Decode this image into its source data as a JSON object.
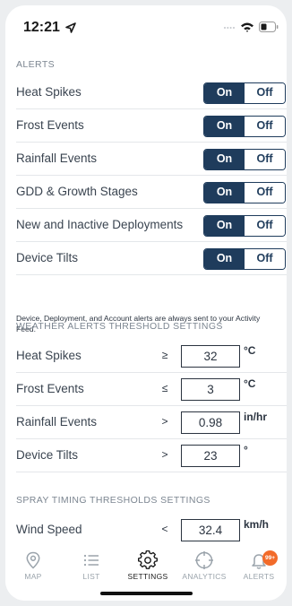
{
  "status_bar": {
    "time": "12:21"
  },
  "alerts": {
    "header": "ALERTS",
    "items": [
      {
        "label": "Heat Spikes",
        "on": "On",
        "off": "Off",
        "state": "on"
      },
      {
        "label": "Frost Events",
        "on": "On",
        "off": "Off",
        "state": "on"
      },
      {
        "label": "Rainfall Events",
        "on": "On",
        "off": "Off",
        "state": "on"
      },
      {
        "label": "GDD & Growth Stages",
        "on": "On",
        "off": "Off",
        "state": "on"
      },
      {
        "label": "New and Inactive Deployments",
        "on": "On",
        "off": "Off",
        "state": "on"
      },
      {
        "label": "Device Tilts",
        "on": "On",
        "off": "Off",
        "state": "on"
      }
    ],
    "note": "Device, Deployment, and Account alerts are always sent to your Activity Feed."
  },
  "weather_thresholds": {
    "header": "WEATHER ALERTS THRESHOLD SETTINGS",
    "items": [
      {
        "label": "Heat Spikes",
        "comparator": "≥",
        "value": "32",
        "unit": "°C"
      },
      {
        "label": "Frost Events",
        "comparator": "≤",
        "value": "3",
        "unit": "°C"
      },
      {
        "label": "Rainfall Events",
        "comparator": ">",
        "value": "0.98",
        "unit": "in/hr"
      },
      {
        "label": "Device Tilts",
        "comparator": ">",
        "value": "23",
        "unit": "°"
      }
    ]
  },
  "spray_thresholds": {
    "header": "SPRAY TIMING THRESHOLDS SETTINGS",
    "items": [
      {
        "label": "Wind Speed",
        "comparator": "<",
        "value": "32.4",
        "unit": "km/h"
      }
    ]
  },
  "tabbar": {
    "tabs": [
      {
        "label": "MAP",
        "icon": "map-pin-icon"
      },
      {
        "label": "LIST",
        "icon": "list-icon"
      },
      {
        "label": "SETTINGS",
        "icon": "gear-icon",
        "active": true
      },
      {
        "label": "ANALYTICS",
        "icon": "crosshair-icon"
      },
      {
        "label": "ALERTS",
        "icon": "bell-icon",
        "badge": "99+"
      }
    ]
  },
  "colors": {
    "accent": "#1f3c5c",
    "badge": "#f26b2a",
    "muted": "#9aa3ab"
  }
}
